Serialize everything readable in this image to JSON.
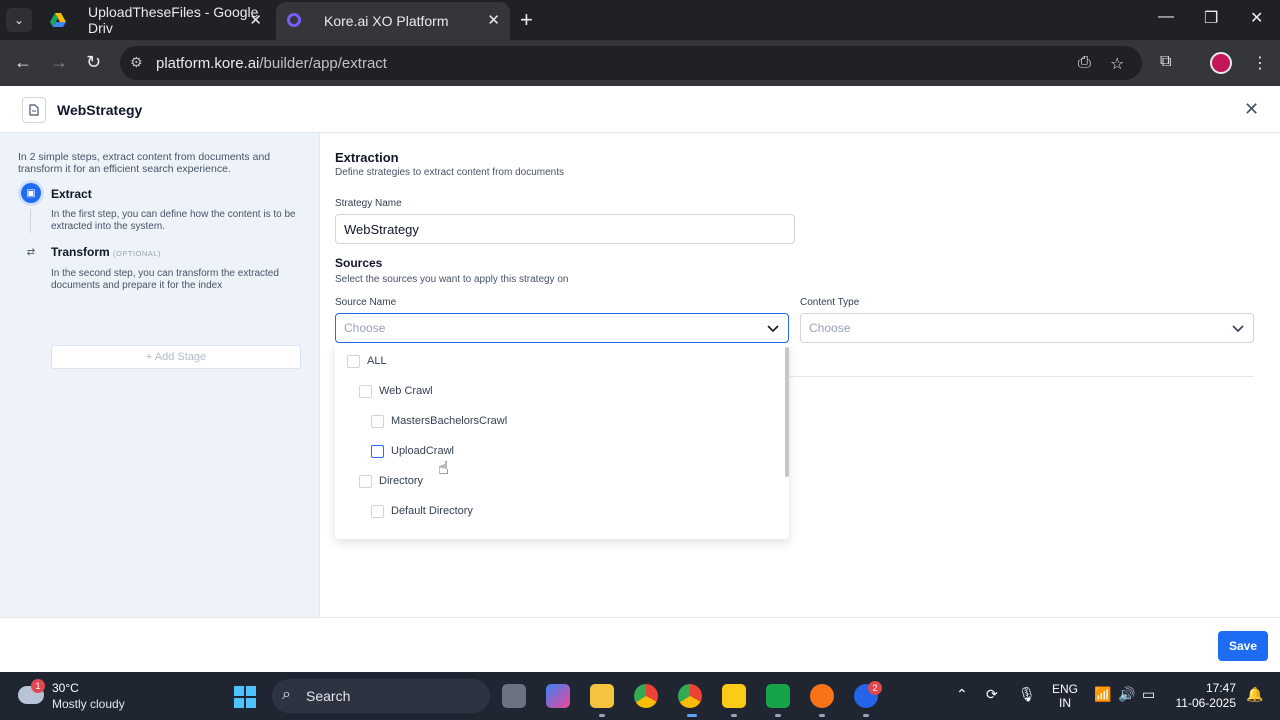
{
  "browser": {
    "tabs": [
      {
        "title": "UploadTheseFiles - Google Driv",
        "active": false
      },
      {
        "title": "Kore.ai XO Platform",
        "active": true
      }
    ],
    "url_host": "platform.kore.ai",
    "url_path": "/builder/app/extract"
  },
  "app": {
    "title": "WebStrategy",
    "sidebar": {
      "intro": "In 2 simple steps, extract content from documents and transform it for an efficient search experience.",
      "steps": [
        {
          "title": "Extract",
          "desc": "In the first step, you can define how the content is to be extracted into the system."
        },
        {
          "title": "Transform",
          "badge": "(OPTIONAL)",
          "desc": "In the second step, you can transform the extracted documents and prepare it for the index"
        }
      ],
      "add_stage": "+ Add Stage"
    },
    "main": {
      "extraction_title": "Extraction",
      "extraction_sub": "Define strategies to extract content from documents",
      "strategy_name_label": "Strategy Name",
      "strategy_name_value": "WebStrategy",
      "sources_title": "Sources",
      "sources_sub": "Select the sources you want to apply this strategy on",
      "source_name_label": "Source Name",
      "source_name_placeholder": "Choose",
      "content_type_label": "Content Type",
      "content_type_placeholder": "Choose",
      "dropdown_items": [
        {
          "label": "ALL",
          "level": 0,
          "checked": false
        },
        {
          "label": "Web Crawl",
          "level": 1,
          "checked": false
        },
        {
          "label": "MastersBachelorsCrawl",
          "level": 2,
          "checked": false
        },
        {
          "label": "UploadCrawl",
          "level": 2,
          "checked": false
        },
        {
          "label": "Directory",
          "level": 1,
          "checked": false
        },
        {
          "label": "Default Directory",
          "level": 2,
          "checked": false
        }
      ]
    },
    "save_label": "Save"
  },
  "taskbar": {
    "weather_temp": "30°C",
    "weather_cond": "Mostly cloudy",
    "weather_badge": "1",
    "search_label": "Search",
    "zoom_badge": "2",
    "lang_line1": "ENG",
    "lang_line2": "IN",
    "time": "17:47",
    "date": "11-06-2025"
  }
}
